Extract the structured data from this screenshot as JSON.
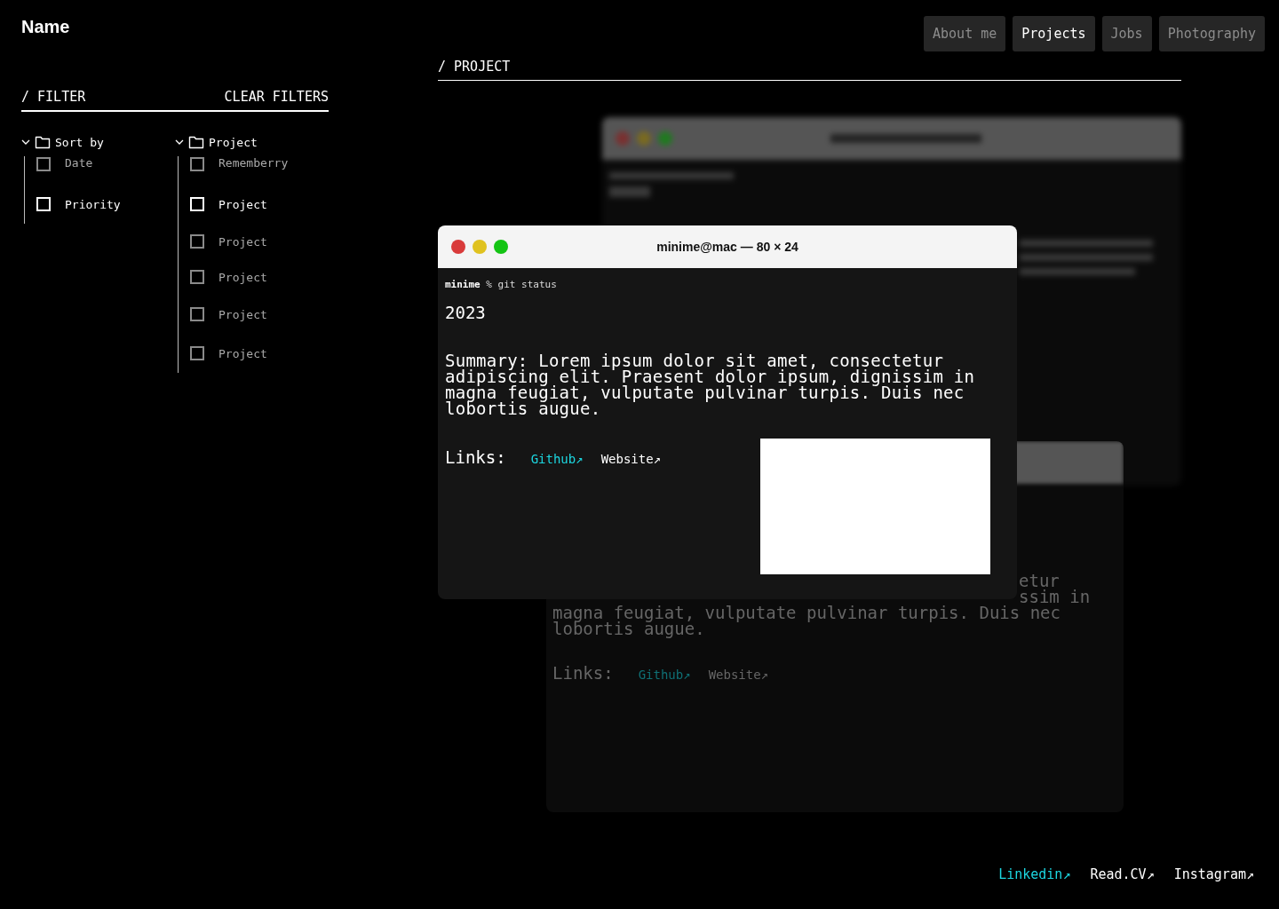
{
  "site_name": "Name",
  "nav": [
    {
      "label": "About me",
      "selected": false
    },
    {
      "label": "Projects",
      "selected": true
    },
    {
      "label": "Jobs",
      "selected": false
    },
    {
      "label": "Photography",
      "selected": false
    }
  ],
  "filter": {
    "title": "/ FILTER",
    "clear_label": "CLEAR FILTERS",
    "groups": [
      {
        "label": "Sort by",
        "expanded": true,
        "items": [
          {
            "label": "Date",
            "checked": false,
            "highlighted": false
          },
          {
            "label": "Priority",
            "checked": false,
            "highlighted": true
          }
        ]
      },
      {
        "label": "Project",
        "expanded": true,
        "items": [
          {
            "label": "Rememberry",
            "checked": false,
            "highlighted": false
          },
          {
            "label": "Project",
            "checked": false,
            "highlighted": true
          },
          {
            "label": "Project",
            "checked": false,
            "highlighted": false
          },
          {
            "label": "Project",
            "checked": false,
            "highlighted": false
          },
          {
            "label": "Project",
            "checked": false,
            "highlighted": false
          },
          {
            "label": "Project",
            "checked": false,
            "highlighted": false
          }
        ]
      }
    ]
  },
  "section_title": "/ PROJECT",
  "terminal": {
    "title": "minime@mac — 80 × 24",
    "prompt_user": "minime",
    "prompt_command": "% git status",
    "year": "2023",
    "summary": "Summary: Lorem ipsum dolor sit amet, consectetur adipiscing elit. Praesent dolor ipsum, dignissim in magna feugiat, vulputate pulvinar turpis. Duis nec lobortis augue.",
    "links_label": "Links:",
    "links": [
      {
        "label": "Github↗",
        "selected": true
      },
      {
        "label": "Website↗",
        "selected": false
      }
    ],
    "image": {
      "kind": "blank"
    }
  },
  "background_window": {
    "lines": [
      {
        "kind": "fragment",
        "text": "etur"
      },
      {
        "kind": "fragment",
        "text": "ssim in"
      },
      {
        "kind": "line",
        "text": "magna feugiat, vulputate pulvinar turpis. Duis nec"
      },
      {
        "kind": "line",
        "text": "lobortis augue."
      }
    ],
    "links_label": "Links:",
    "links": [
      {
        "label": "Github↗",
        "selected": true
      },
      {
        "label": "Website↗",
        "selected": false
      }
    ]
  },
  "footer_links": [
    {
      "label": "Linkedin↗",
      "selected": true
    },
    {
      "label": "Read.CV↗",
      "selected": false
    },
    {
      "label": "Instagram↗",
      "selected": false
    }
  ]
}
